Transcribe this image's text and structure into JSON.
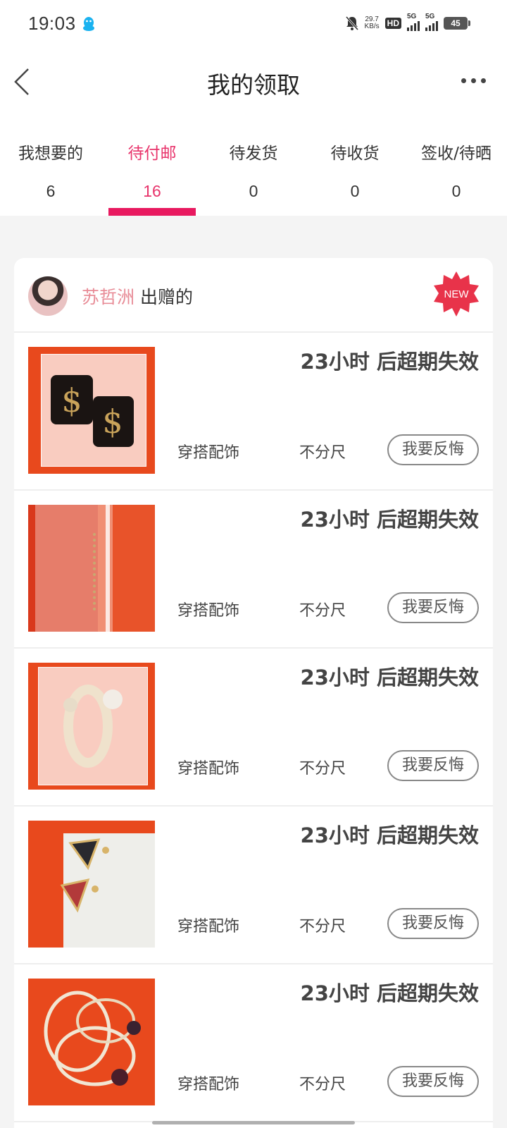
{
  "status_bar": {
    "time": "19:03",
    "net_speed_value": "29.7",
    "net_speed_unit": "KB/s",
    "hd_label": "HD",
    "signal1_label": "5G",
    "signal2_label": "5G",
    "battery": "45",
    "icons": [
      "qq-icon",
      "mute-bell-icon",
      "signal-icon",
      "battery-icon"
    ]
  },
  "nav": {
    "title": "我的领取",
    "back_icon": "chevron-left-icon",
    "more_icon": "more-dots-icon"
  },
  "tabs": [
    {
      "label": "我想要的",
      "count": "6",
      "active": false
    },
    {
      "label": "待付邮",
      "count": "16",
      "active": true
    },
    {
      "label": "待发货",
      "count": "0",
      "active": false
    },
    {
      "label": "待收货",
      "count": "0",
      "active": false
    },
    {
      "label": "签收/待晒",
      "count": "0",
      "active": false
    }
  ],
  "card": {
    "giver_name": "苏哲洲",
    "giver_suffix": "出赠的",
    "badge": "NEW",
    "items": [
      {
        "expire": "23小时 后超期失效",
        "category": "穿搭配饰",
        "size": "不分尺",
        "action": "我要反悔"
      },
      {
        "expire": "23小时 后超期失效",
        "category": "穿搭配饰",
        "size": "不分尺",
        "action": "我要反悔"
      },
      {
        "expire": "23小时 后超期失效",
        "category": "穿搭配饰",
        "size": "不分尺",
        "action": "我要反悔"
      },
      {
        "expire": "23小时 后超期失效",
        "category": "穿搭配饰",
        "size": "不分尺",
        "action": "我要反悔"
      },
      {
        "expire": "23小时 后超期失效",
        "category": "穿搭配饰",
        "size": "不分尺",
        "action": "我要反悔"
      }
    ]
  },
  "colors": {
    "accent": "#e8195f",
    "active_tab_text": "#e8336b",
    "giver_name": "#e88c97",
    "new_badge": "#e8334a",
    "thumb_bg": "#e8491d"
  }
}
